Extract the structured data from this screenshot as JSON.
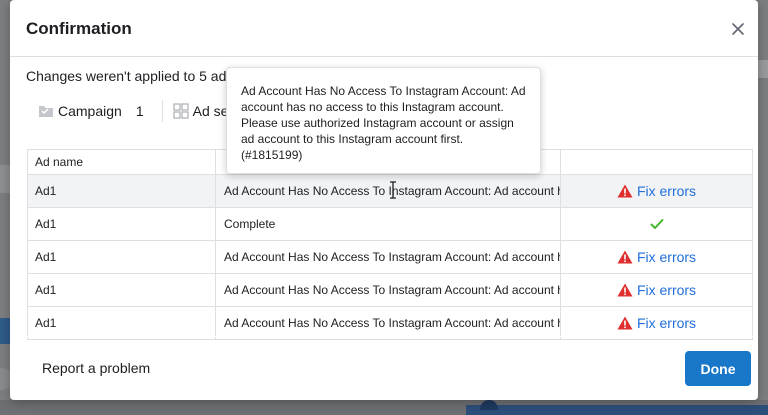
{
  "modal": {
    "title": "Confirmation",
    "message": "Changes weren't applied to 5 ad",
    "filters": [
      {
        "label": "Campaign",
        "count": "1",
        "icon": "folder-icon"
      },
      {
        "label": "Ad se",
        "icon": "grid-icon"
      }
    ]
  },
  "table": {
    "headers": {
      "name": "Ad name",
      "status": "",
      "action": ""
    },
    "rows": [
      {
        "name": "Ad1",
        "status": "Ad Account Has No Access To Instagram Account: Ad account h",
        "action": "Fix errors",
        "state": "error"
      },
      {
        "name": "Ad1",
        "status": "Complete",
        "action": "",
        "state": "complete"
      },
      {
        "name": "Ad1",
        "status": "Ad Account Has No Access To Instagram Account: Ad account h",
        "action": "Fix errors",
        "state": "error"
      },
      {
        "name": "Ad1",
        "status": "Ad Account Has No Access To Instagram Account: Ad account h",
        "action": "Fix errors",
        "state": "error"
      },
      {
        "name": "Ad1",
        "status": "Ad Account Has No Access To Instagram Account: Ad account h",
        "action": "Fix errors",
        "state": "error"
      }
    ]
  },
  "tooltip": {
    "lines": [
      "Ad Account Has No Access To Instagram Account: Ad",
      "account has no access to this Instagram account.",
      "Please use authorized Instagram account or assign",
      "ad account to this Instagram account first.",
      "(#1815199)"
    ]
  },
  "footer": {
    "report_label": "Report a problem",
    "done_label": "Done"
  },
  "colors": {
    "primary": "#1877c9",
    "link": "#216fdb",
    "error": "#e02e2e",
    "success": "#42b72a"
  }
}
